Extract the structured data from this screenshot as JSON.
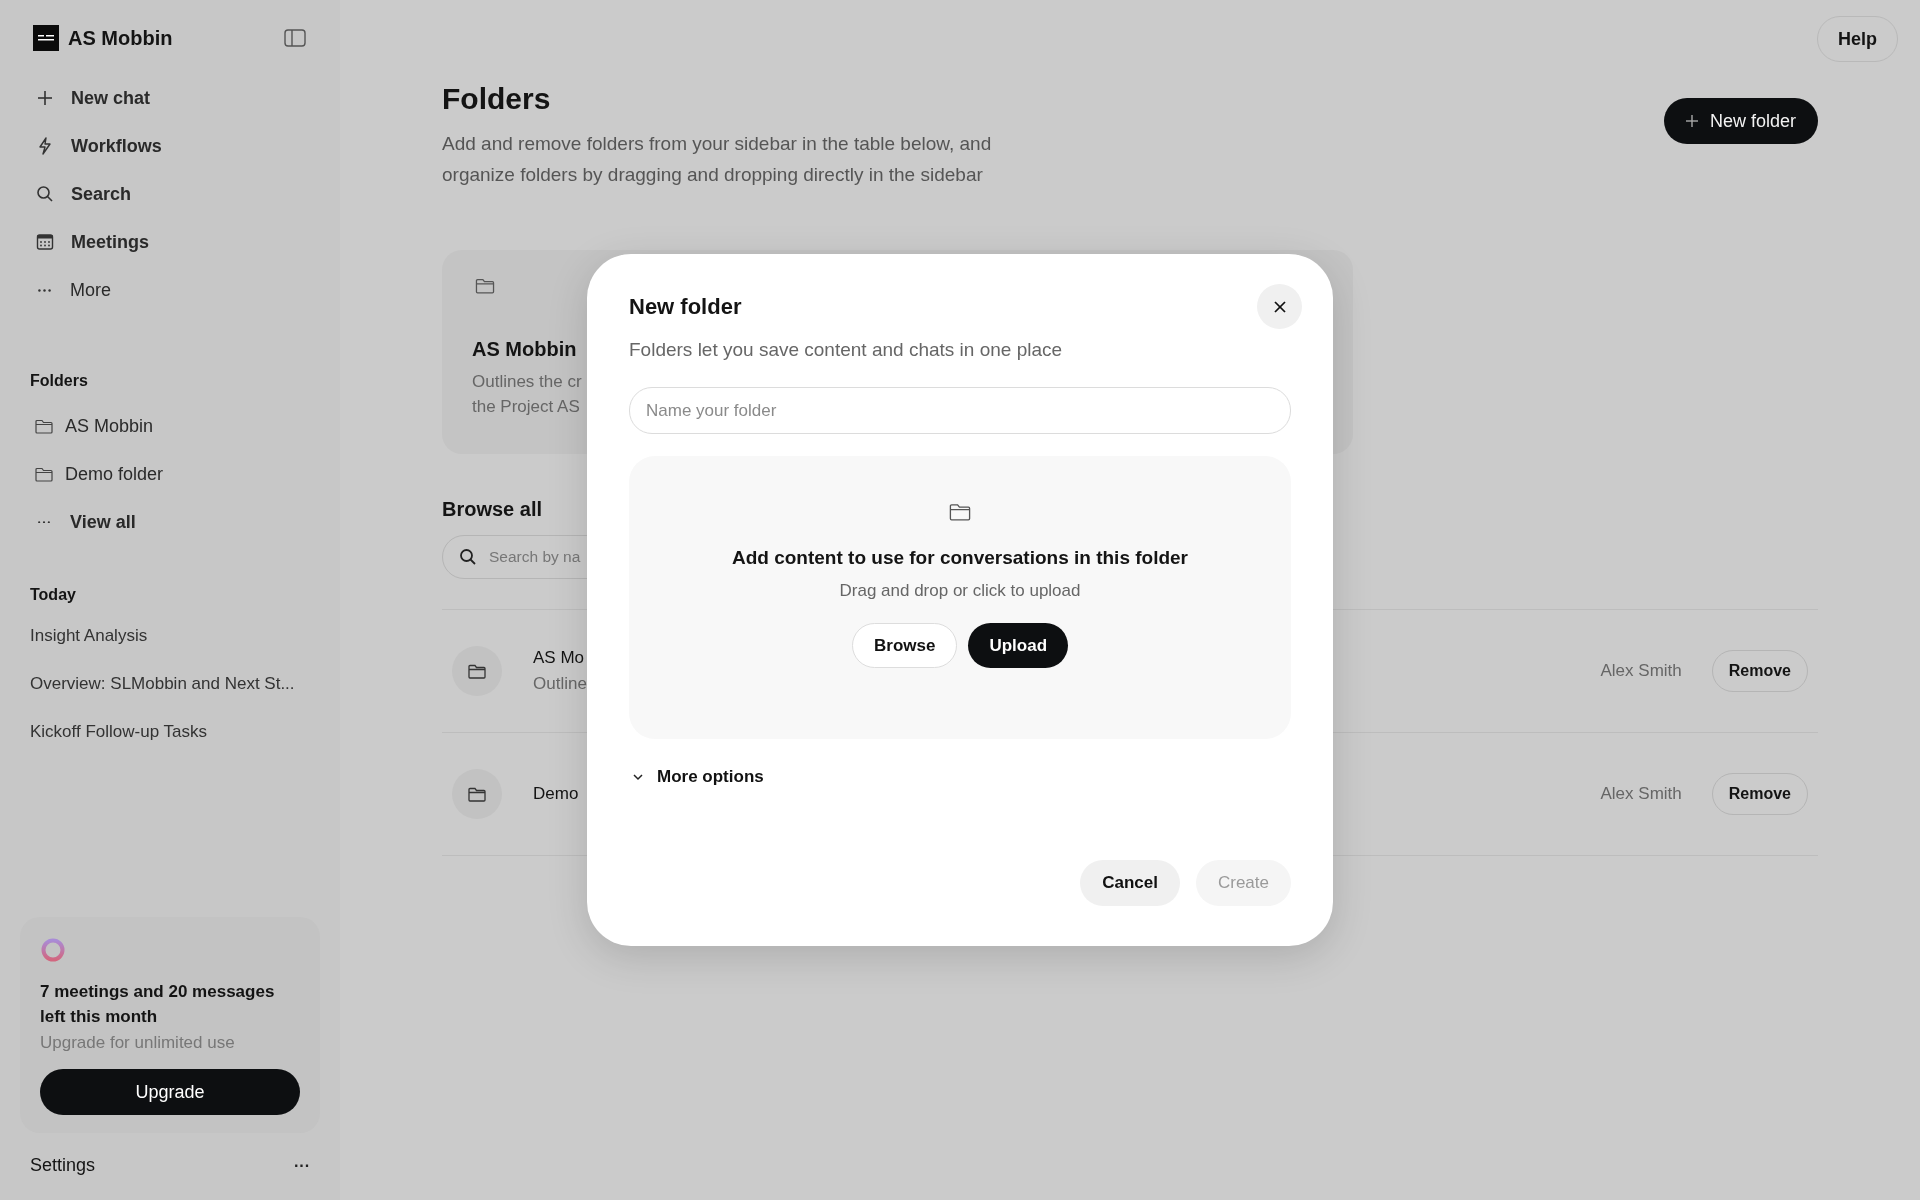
{
  "sidebar": {
    "workspace": "AS Mobbin",
    "nav": [
      {
        "label": "New chat",
        "kind": "plus"
      },
      {
        "label": "Workflows",
        "kind": "bolt"
      },
      {
        "label": "Search",
        "kind": "search"
      },
      {
        "label": "Meetings",
        "kind": "calendar"
      },
      {
        "label": "More",
        "kind": "more"
      }
    ],
    "folders_heading": "Folders",
    "folders": [
      {
        "label": "AS Mobbin",
        "kind": "folder"
      },
      {
        "label": "Demo folder",
        "kind": "folder"
      },
      {
        "label": "View all",
        "kind": "more"
      }
    ],
    "today_heading": "Today",
    "chats": [
      "Insight Analysis",
      "Overview: SLMobbin and Next St...",
      "Kickoff Follow-up Tasks"
    ],
    "usage": {
      "title": "7 meetings and 20 messages left this month",
      "subtitle": "Upgrade for unlimited use",
      "button": "Upgrade"
    },
    "settings": "Settings",
    "settings_menu": "···"
  },
  "help_button": "Help",
  "page": {
    "title": "Folders",
    "description": "Add and remove folders from your sidebar in the table below, and organize folders by dragging and dropping directly in the sidebar",
    "new_folder_button": "New folder",
    "card": {
      "title": "AS Mobbin",
      "description_lines": [
        "Outlines the cr",
        "the Project AS"
      ]
    },
    "browse_heading": "Browse all",
    "search": {
      "placeholder": "Search by na"
    },
    "rows": [
      {
        "name": "AS Mo",
        "description": "Outline",
        "owner": "Alex Smith",
        "action": "Remove"
      },
      {
        "name": "Demo",
        "owner": "Alex Smith",
        "action": "Remove"
      }
    ]
  },
  "dialog": {
    "title": "New folder",
    "subtitle": "Folders let you save content and chats in one place",
    "name_field": {
      "placeholder": "Name your folder"
    },
    "dropzone": {
      "heading": "Add content to use for conversations in this folder",
      "hint": "Drag and drop or click to upload",
      "buttons": [
        {
          "label": "Browse",
          "kind": "secondary"
        },
        {
          "label": "Upload",
          "kind": "primary"
        }
      ]
    },
    "more_options": {
      "label": "More options",
      "expanded": false
    },
    "footer": [
      {
        "label": "Cancel",
        "disabled": false
      },
      {
        "label": "Create",
        "disabled": true
      }
    ]
  }
}
